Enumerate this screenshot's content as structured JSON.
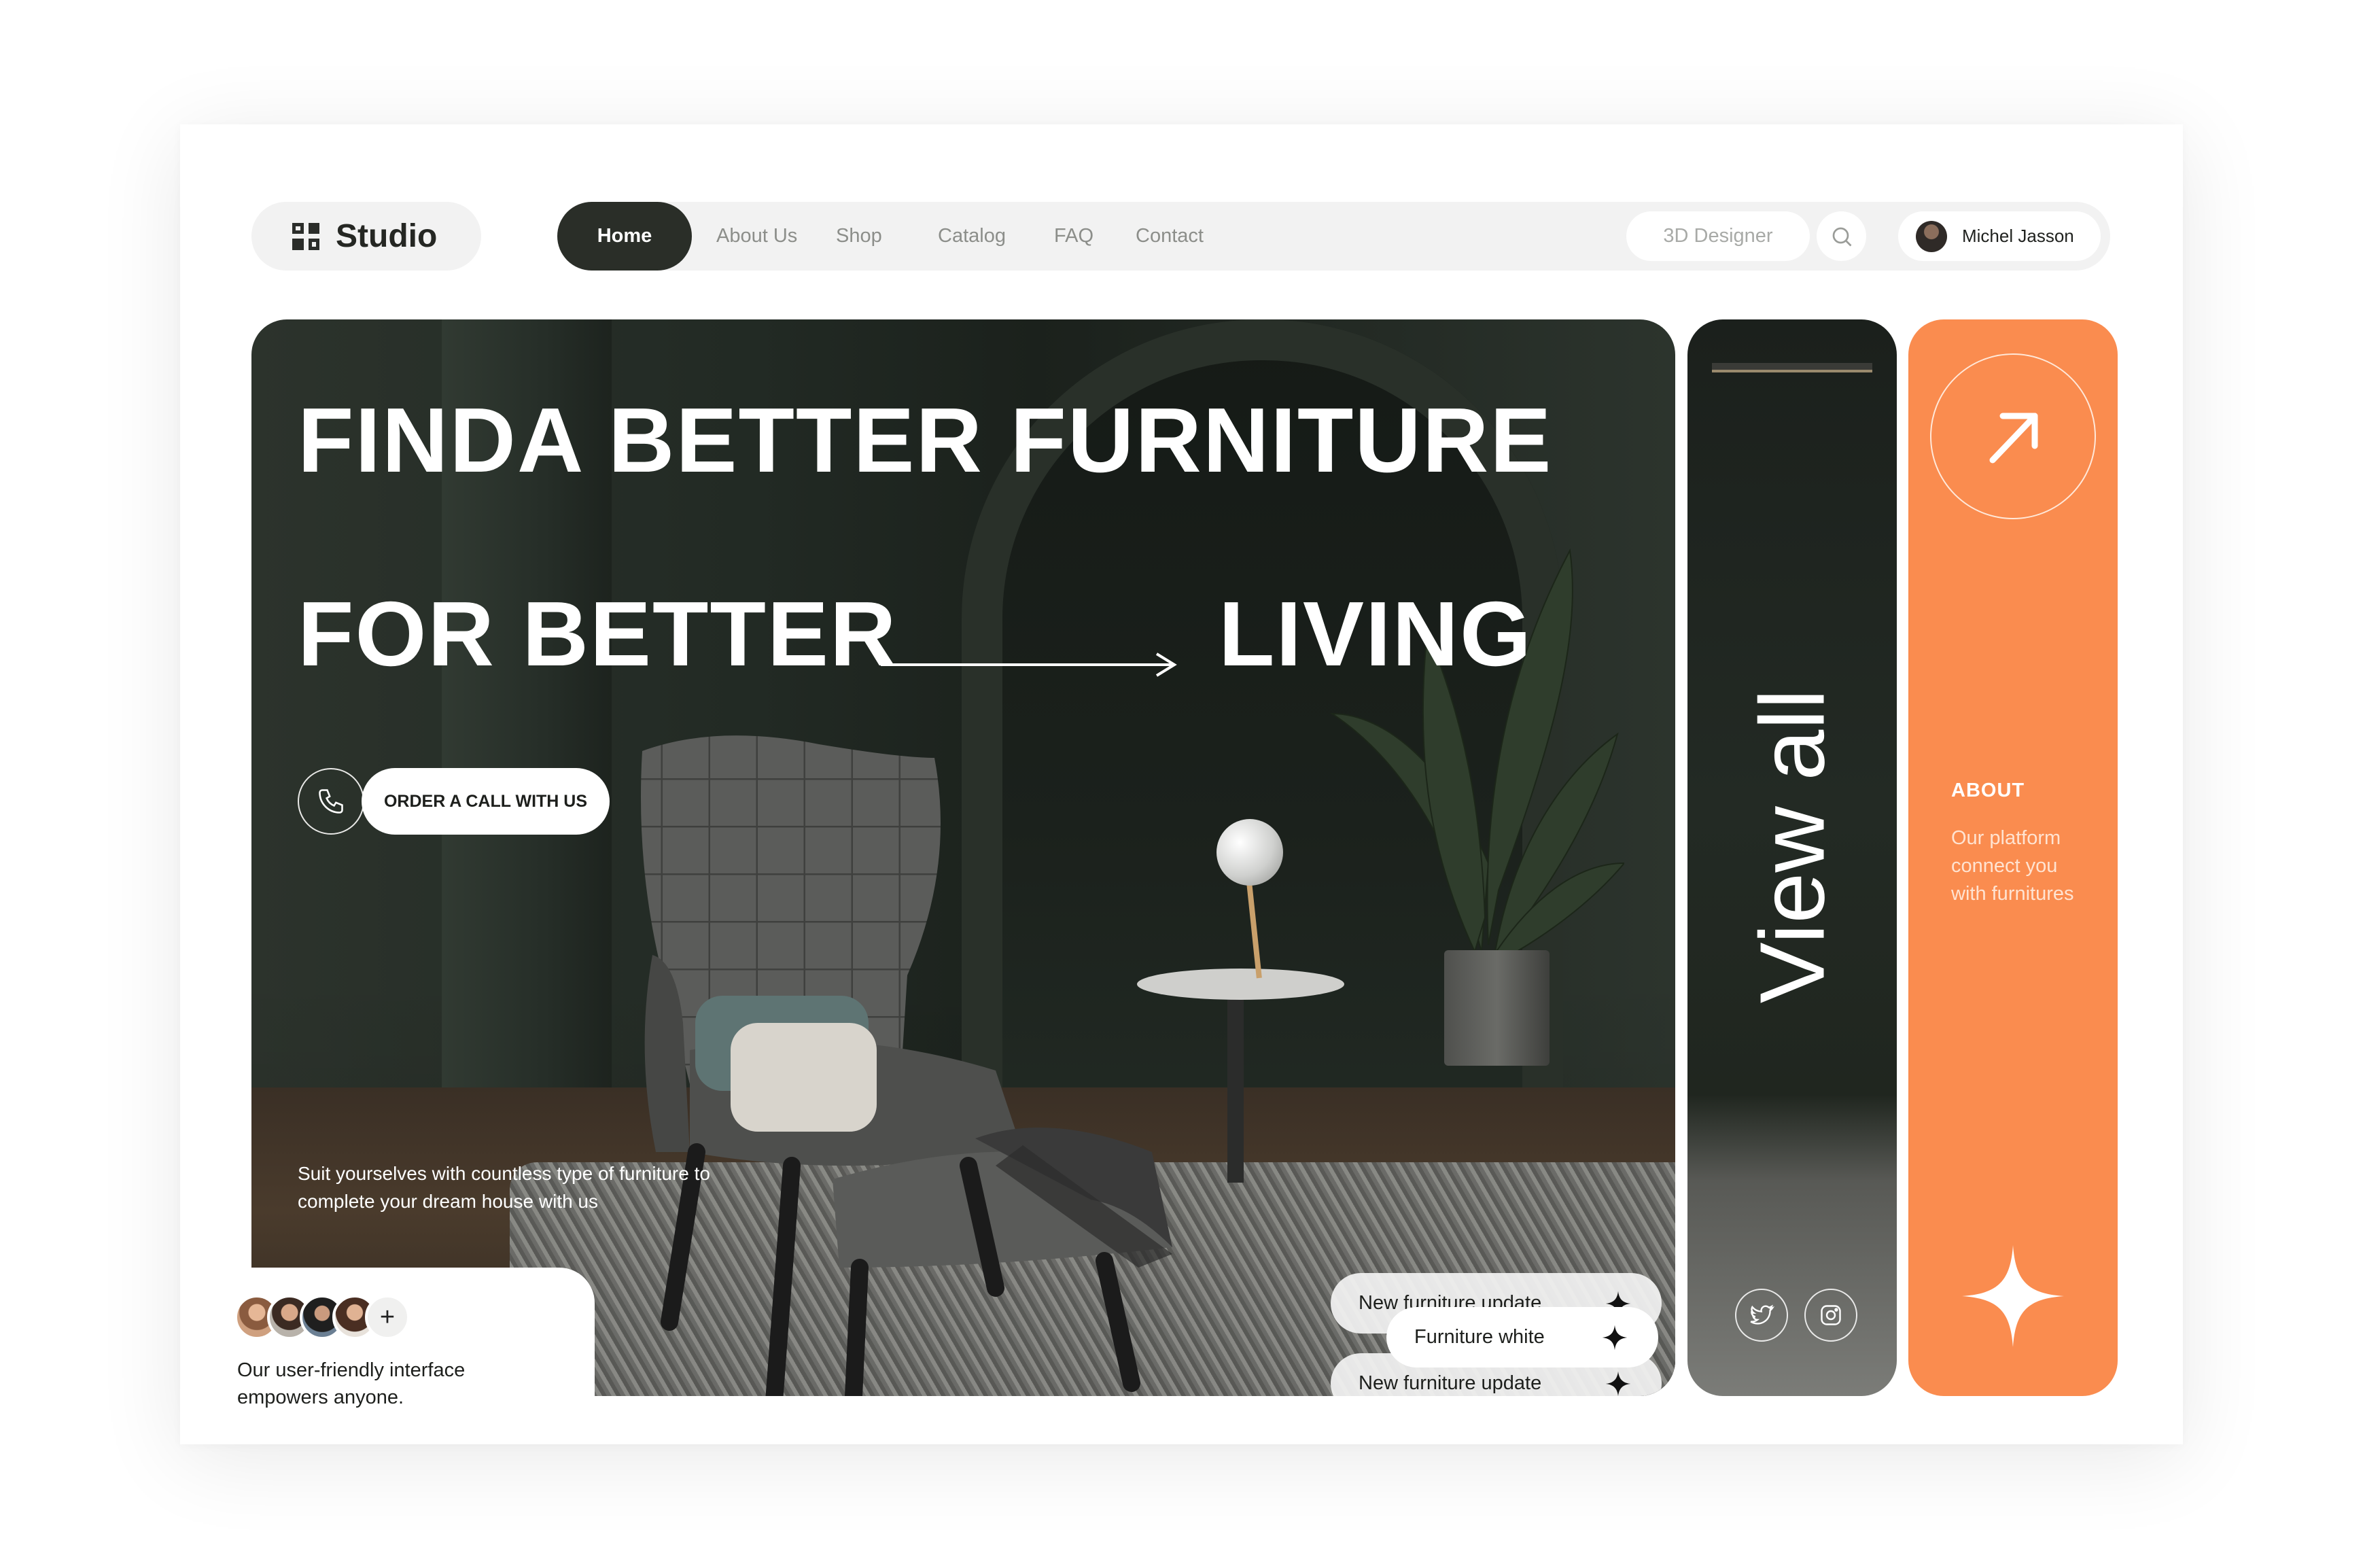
{
  "brand": {
    "name": "Studio",
    "icon": "qr-code-icon"
  },
  "nav": {
    "items": [
      {
        "label": "Home",
        "active": true
      },
      {
        "label": "About Us"
      },
      {
        "label": "Shop"
      },
      {
        "label": "Catalog"
      },
      {
        "label": "FAQ"
      },
      {
        "label": "Contact"
      }
    ]
  },
  "search": {
    "placeholder": "3D Designer",
    "icon": "search-icon"
  },
  "user": {
    "name": "Michel Jasson"
  },
  "hero": {
    "title_line1": "FINDA BETTER FURNITURE",
    "title_line2_left": "FOR BETTER",
    "title_line2_right": "LIVING",
    "cta_label": "ORDER A CALL WITH US",
    "cta_icon": "phone-icon",
    "description": "Suit yourselves with countless type of furniture to complete your dream house with us",
    "updates": [
      {
        "label": "New furniture update",
        "icon": "sparkle-icon"
      },
      {
        "label": "New furniture update",
        "icon": "sparkle-icon"
      },
      {
        "label": "Furniture white",
        "icon": "sparkle-icon"
      }
    ]
  },
  "community": {
    "text": "Our user-friendly interface empowers anyone.",
    "more_label": "+"
  },
  "view_panel": {
    "label": "View all",
    "socials": [
      "twitter-icon",
      "instagram-icon"
    ]
  },
  "about_panel": {
    "heading": "ABOUT",
    "text": "Our platform connect you with furnitures",
    "icon": "arrow-up-right-icon"
  },
  "colors": {
    "accent": "#fa8c4f",
    "dark": "#2a2e28",
    "pill_bg": "#f2f2f2"
  }
}
